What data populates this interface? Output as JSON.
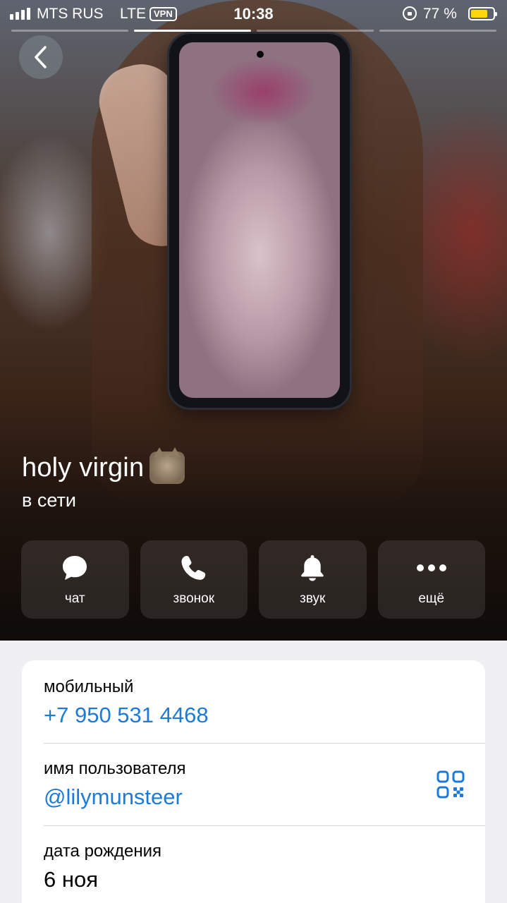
{
  "status_bar": {
    "carrier": "MTS RUS",
    "network": "LTE",
    "vpn": "VPN",
    "time": "10:38",
    "battery": "77 %",
    "battery_level": 0.77,
    "battery_color": "#ffd60a"
  },
  "story_segments": {
    "count": 4,
    "active_index": 1
  },
  "profile": {
    "name": "holy virgin",
    "status": "в сети"
  },
  "actions": [
    {
      "label": "чат",
      "icon": "chat-bubble-icon"
    },
    {
      "label": "звонок",
      "icon": "phone-icon"
    },
    {
      "label": "звук",
      "icon": "bell-icon"
    },
    {
      "label": "ещё",
      "icon": "more-dots-icon"
    }
  ],
  "info": {
    "mobile_label": "мобильный",
    "mobile_value": "+7 950 531 4468",
    "username_label": "имя пользователя",
    "username_value": "@lilymunsteer",
    "birthday_label": "дата рождения",
    "birthday_value": "6 ноя"
  },
  "colors": {
    "accent": "#1d7bd8",
    "background": "#efeff4"
  }
}
